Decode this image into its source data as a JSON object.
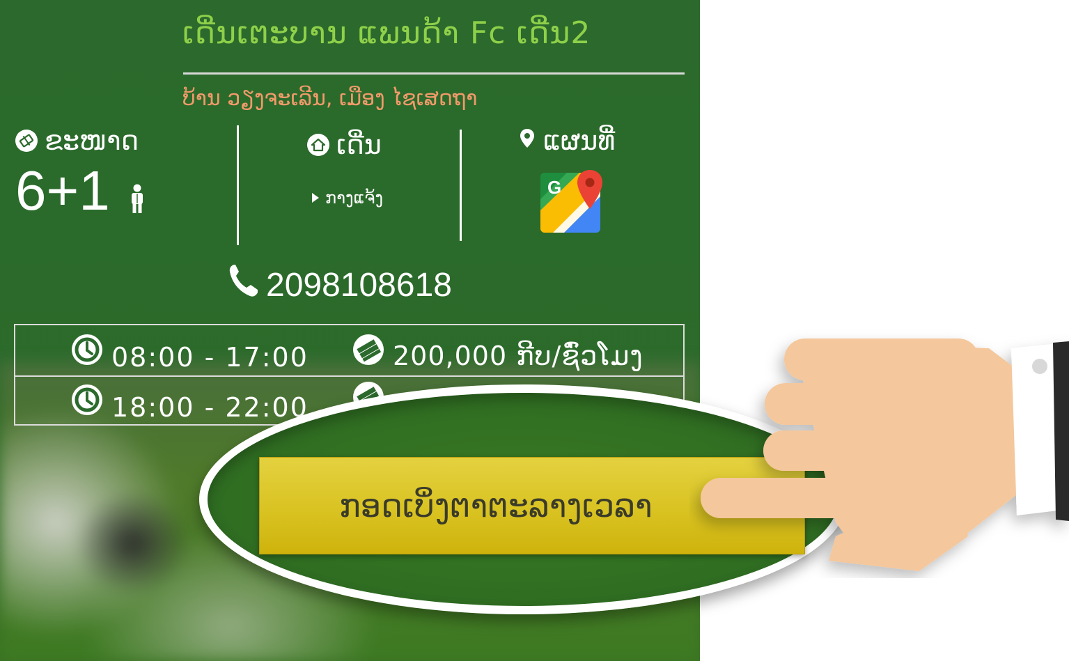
{
  "venue": {
    "name": "ເດີ່ນເຕະບານ ແພນດ້າ Fc ເດີ່ນ2",
    "address": "ບ້ານ ວຽງຈະເລີນ, ເມືອງ ໄຊເສດຖາ"
  },
  "info": {
    "size_label": "ຂະໜາດ",
    "size_value": "6+1",
    "pitch_label": "ເດີ່ນ",
    "pitch_item": "ກາງແຈ້ງ",
    "map_label": "ແຜນທີ່"
  },
  "contact": {
    "phone": "2098108618"
  },
  "schedule": [
    {
      "time": "08:00 - 17:00",
      "price": "200,000 ກີບ/ຊົ່ວໂມງ"
    },
    {
      "time": "18:00 - 22:00",
      "price": ""
    }
  ],
  "cta": {
    "label": "ກອດເບິ່ງຕາຕະລາງເວລາ"
  },
  "colors": {
    "panel_green": "#2b6a2c",
    "title_green": "#8fd04a",
    "address_orange": "#f19a6a",
    "button_yellow": "#d9c322",
    "hand_skin": "#f4c79c"
  },
  "icons": {
    "size": "pitch-icon",
    "pitch": "home-icon",
    "map": "map-pin-icon",
    "maps_app": "google-maps-icon",
    "phone": "phone-icon",
    "time": "clock-icon",
    "price": "money-icon",
    "bullet": "play-triangle-icon",
    "person": "person-icon",
    "pointer": "pointing-hand-icon"
  }
}
